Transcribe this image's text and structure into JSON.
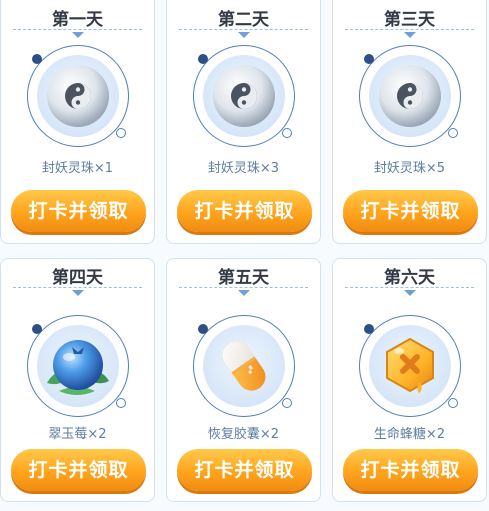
{
  "cards": [
    {
      "day": "第一天",
      "reward": "封妖灵珠×1",
      "button": "打卡并领取",
      "icon": "yin-yang-pearl-icon"
    },
    {
      "day": "第二天",
      "reward": "封妖灵珠×3",
      "button": "打卡并领取",
      "icon": "yin-yang-pearl-icon"
    },
    {
      "day": "第三天",
      "reward": "封妖灵珠×5",
      "button": "打卡并领取",
      "icon": "yin-yang-pearl-icon"
    },
    {
      "day": "第四天",
      "reward": "翠玉莓×2",
      "button": "打卡并领取",
      "icon": "blueberry-icon"
    },
    {
      "day": "第五天",
      "reward": "恢复胶囊×2",
      "button": "打卡并领取",
      "icon": "recovery-capsule-icon"
    },
    {
      "day": "第六天",
      "reward": "生命蜂糖×2",
      "button": "打卡并领取",
      "icon": "honey-candy-icon"
    }
  ],
  "colors": {
    "button_top": "#ffc94a",
    "button_bottom": "#f08b12",
    "ring": "#4d7fbd",
    "card_border": "#cfe2f3"
  }
}
